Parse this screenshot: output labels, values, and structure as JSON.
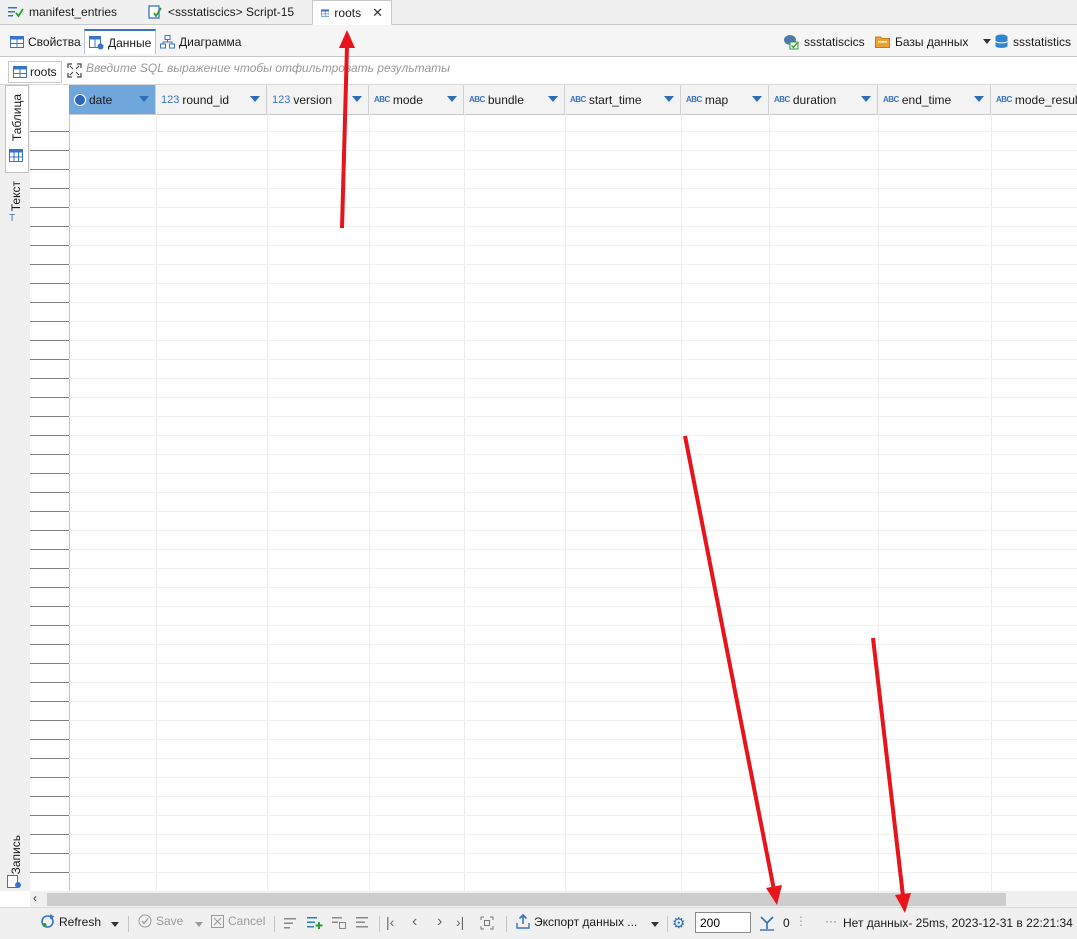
{
  "editor_tabs": [
    {
      "label": "manifest_entries",
      "icon": "table-check-icon",
      "active": false
    },
    {
      "label": "<ssstatiscics> Script-15",
      "icon": "script-icon",
      "active": false
    },
    {
      "label": "roots",
      "icon": "table-icon",
      "active": true
    }
  ],
  "sub_tabs": [
    {
      "label": "Свойства",
      "icon": "table-icon"
    },
    {
      "label": "Данные",
      "icon": "data-icon"
    },
    {
      "label": "Диаграмма",
      "icon": "diagram-icon"
    }
  ],
  "right_toolbar": {
    "datasource": "ssstatiscics",
    "databases": "Базы данных",
    "schema": "ssstatistics"
  },
  "filter": {
    "table_chip": "roots",
    "placeholder": "Введите SQL выражение чтобы отфильтровать результаты"
  },
  "left_panel": {
    "table_tab": "Таблица",
    "text_tab": "Текст",
    "record_tab": "Запись"
  },
  "columns": [
    {
      "type": "date",
      "label": "date"
    },
    {
      "type": "123",
      "label": "round_id"
    },
    {
      "type": "123",
      "label": "version"
    },
    {
      "type": "ABC",
      "label": "mode"
    },
    {
      "type": "ABC",
      "label": "bundle"
    },
    {
      "type": "ABC",
      "label": "start_time"
    },
    {
      "type": "ABC",
      "label": "map"
    },
    {
      "type": "ABC",
      "label": "duration"
    },
    {
      "type": "ABC",
      "label": "end_time"
    },
    {
      "type": "ABC",
      "label": "mode_result"
    }
  ],
  "toolbar": {
    "refresh": "Refresh",
    "save": "Save",
    "cancel": "Cancel",
    "export": "Экспорт данных ...",
    "fetch_size": "200",
    "row_count": "0",
    "status": "Нет данных- 25ms, 2023-12-31 в 22:21:34"
  },
  "colors": {
    "accent": "#3a74c4",
    "selected_header": "#6fa7dc",
    "arrow": "#e8141b"
  }
}
